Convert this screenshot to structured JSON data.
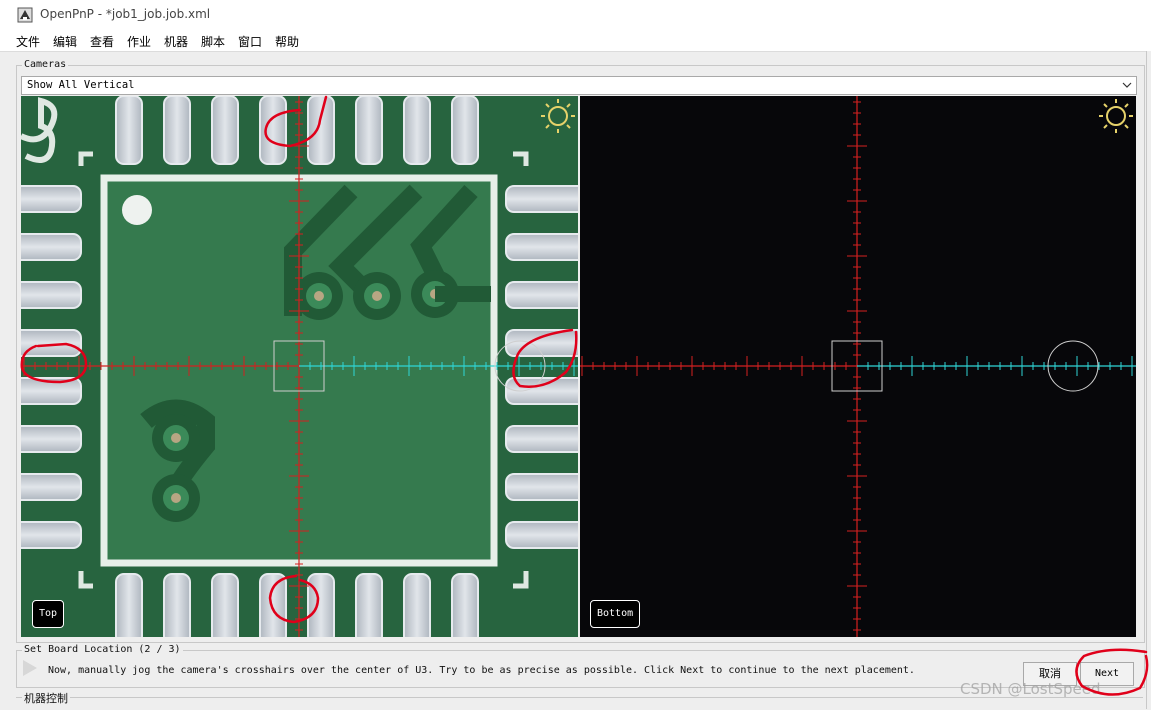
{
  "window": {
    "title": "OpenPnP - *job1_job.job.xml"
  },
  "menubar": {
    "items": [
      "文件",
      "编辑",
      "查看",
      "作业",
      "机器",
      "脚本",
      "窗口",
      "帮助"
    ]
  },
  "cameras": {
    "legend": "Cameras",
    "view_mode": "Show All Vertical",
    "views": [
      {
        "label": "Top"
      },
      {
        "label": "Bottom"
      }
    ]
  },
  "wizard": {
    "legend": "Set Board Location (2 / 3)",
    "instructions": "Now, manually jog the camera's crosshairs over the center of U3. Try to be as precise as possible. Click Next to continue to the next placement.",
    "cancel_label": "取消",
    "next_label": "Next"
  },
  "machine_controls": {
    "legend": "机器控制"
  },
  "watermark": "CSDN @LostSpeed",
  "colors": {
    "crosshair": "#d42020",
    "reticle": "#2fd6d6",
    "annotation": "#e0001a",
    "pcb_mask": "#2f7a4a",
    "pad": "#c9cfd6",
    "bottom_view_bg": "#07070a",
    "sun_icon": "#e6d26a"
  },
  "icons": {
    "light_toggle": "sun-icon",
    "wizard_marker": "arrow-right-icon",
    "combo_arrow": "chevron-down-icon"
  }
}
